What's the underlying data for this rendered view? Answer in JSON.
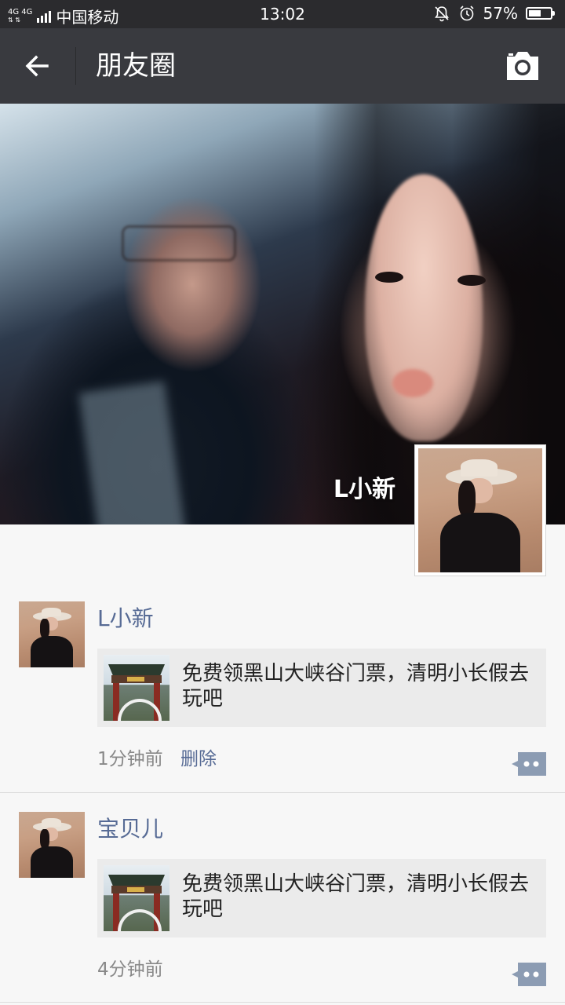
{
  "status_bar": {
    "network": "4G 4G",
    "carrier": "中国移动",
    "time": "13:02",
    "battery_percent": "57%",
    "battery_level": 0.57,
    "icons": [
      "signal-icon",
      "bell-muted-icon",
      "alarm-icon",
      "battery-icon"
    ]
  },
  "navbar": {
    "back_icon": "arrow-left-icon",
    "title": "朋友圈",
    "camera_icon": "camera-icon"
  },
  "cover": {
    "user_name": "L小新"
  },
  "posts": [
    {
      "author": "L小新",
      "share_text": "免费领黑山大峡谷门票，清明小长假去玩吧",
      "time": "1分钟前",
      "delete_label": "删除",
      "comment_icon": "comment-dots-icon"
    },
    {
      "author": "宝贝儿",
      "share_text": "免费领黑山大峡谷门票，清明小长假去玩吧",
      "time": "4分钟前",
      "comment_icon": "comment-dots-icon"
    }
  ],
  "colors": {
    "nav_bg": "#393a3f",
    "status_bg": "#2b2b2e",
    "link_blue": "#576b95",
    "feed_bg": "#f7f7f7",
    "card_bg": "#ebebeb"
  }
}
